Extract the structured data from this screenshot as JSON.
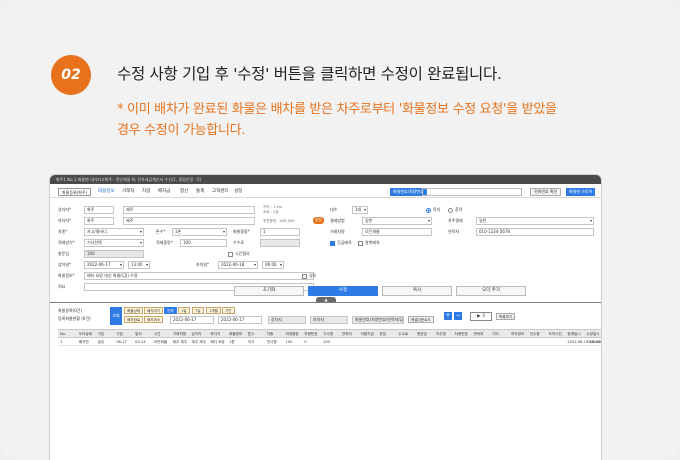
{
  "step": {
    "number": "02"
  },
  "headline": "수정 사항 기입 후 '수정' 버튼을 클릭하면 수정이 완료됩니다.",
  "note": "* 이미 배차가 완료된 화물은 배차를 받은 차주로부터 '화물정보 수정 요청'을 받았을 경우 수정이 가능합니다.",
  "colors": {
    "accent": "#e8721c",
    "primary": "#2f7be5"
  },
  "app": {
    "titlebar": "화주1 No.1 화물맨 네가지고화주 · 전산화물 N, 전자세금계산서 수신(1, 생일인정 : 0)",
    "titlebar_right": "",
    "home_tab": "화물등록(화주)",
    "menu": [
      "화물정보",
      "거래처",
      "차량",
      "배차금",
      "정산",
      "통계",
      "고객센터",
      "설정"
    ],
    "search_button": "화물번호/차량번호",
    "search_placeholder": "",
    "btn_a": "전화번호 확인",
    "btn_b": "화물맨 스토어"
  },
  "form": {
    "shipper_label": "상차지*",
    "shipper_value": "화주",
    "shipper_addr": "제주",
    "receiver_label": "하차지*",
    "receiver_value": "화주",
    "receiver_addr": "제주",
    "dist_note1": "거리 : 1 km",
    "dist_note2": "소요 : 1분",
    "fare_note": "추천운임 : 105,000",
    "fare_btn": "운임",
    "vehicle_label": "차종*",
    "vehicle_value": "카고/윙바디",
    "ton_label": "톤수*",
    "ton_value": "1톤",
    "weight_label": "화물중량*",
    "weight_value": "1",
    "load_label": "적재방식*",
    "load_value": "기사선택",
    "cargo_weight_label": "적재중량*",
    "cargo_weight_value": "100",
    "fee_label": "수수료",
    "amount_label": "총운임",
    "amount_value": "100",
    "date_label": "상차일*",
    "date_value": "2022-06-17",
    "time_value": "13:00",
    "unload_date_label": "하차일*",
    "unload_date_value": "2022-06-18",
    "unload_time_value": "06:00",
    "time_chk": "시간협의",
    "info_label": "화물정보*",
    "info_value": "배차 요망 대신 화물(CJ)) 수정",
    "memo_label": "적요",
    "right_label1": "대수",
    "right_val1": "1대",
    "radio1": "독차",
    "radio2": "혼적",
    "pay_label": "결제방법",
    "pay_value": "일반",
    "pay_label2": "차주결제",
    "pay_value2": "일반",
    "company_label": "거래처명",
    "company_value": "모든화물",
    "contact_label": "연락처",
    "contact_value": "010-1234-5678",
    "chk1": "긴급배차",
    "chk2": "왕복배차",
    "chk3": "경유"
  },
  "actions": {
    "reset": "초기화",
    "edit": "수정",
    "copy": "복사",
    "add": "오더 추가"
  },
  "list": {
    "summary1": "화물등록(0건)",
    "summary2": "등록화물현황 (0건)",
    "big_btn": "조회",
    "tags_row1": [
      "화물상태",
      "배차대기",
      "전체",
      "1일",
      "7일",
      "1개월",
      "기간"
    ],
    "tags_row2": [
      "배차완료",
      "배차취소"
    ],
    "date_from": "2022-06-17",
    "date_to": "2022-06-17",
    "field1": "상차지",
    "field2": "하차지",
    "field3": "화물번호/차량번호/연락처/담당자",
    "export_btn": "엑셀다운로드",
    "play": "▶ 3",
    "page_btn": "목록보기",
    "columns": [
      "No.",
      "오더상태",
      "구분",
      "구분",
      "일자",
      "시간",
      "거래처명",
      "상차지",
      "하차지",
      "화물정보",
      "톤수",
      "차종",
      "적재중량",
      "차량번호",
      "기사명",
      "연락처",
      "차량지급",
      "운임",
      "수수료",
      "총운임",
      "차주명",
      "차량번호",
      "연락처",
      "기타",
      "하차정보",
      "인수증",
      "도착시간",
      "등록일시",
      "수정일시"
    ],
    "row": [
      "1",
      "배차전",
      "공유",
      "06-17",
      "05-14",
      "모든화물",
      "제주 제주",
      "제주 제주",
      "배차 요망",
      "1톤",
      "카고",
      "전사원",
      "100",
      "0",
      "100",
      "",
      "",
      "",
      "",
      "",
      "",
      "",
      "",
      "",
      "",
      "",
      "",
      "2022-06-17 16:40",
      "2022-06-1"
    ]
  }
}
